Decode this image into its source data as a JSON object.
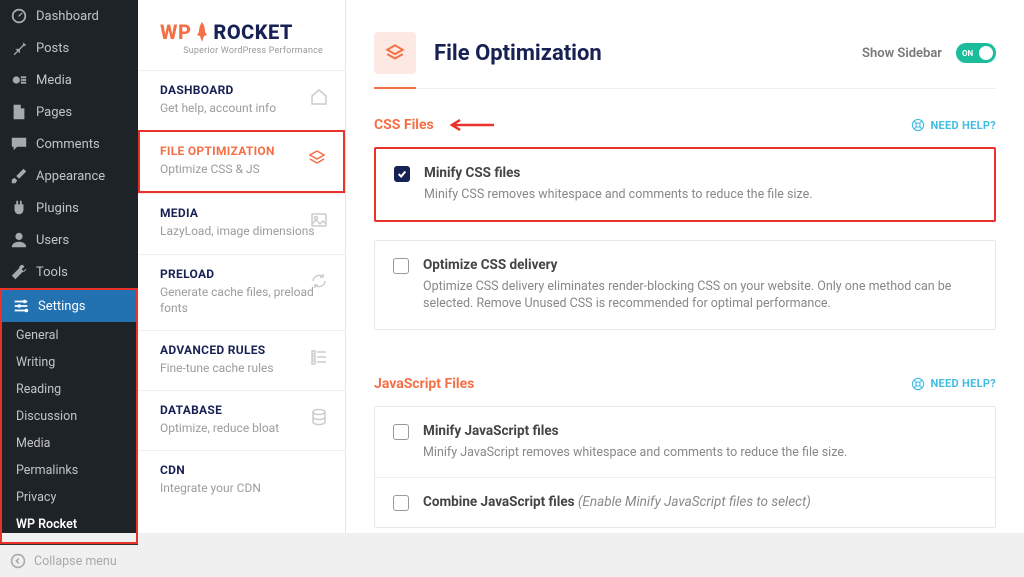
{
  "wp_sidebar": {
    "items": [
      {
        "label": "Dashboard",
        "icon": "gauge"
      },
      {
        "label": "Posts",
        "icon": "pin"
      },
      {
        "label": "Media",
        "icon": "media"
      },
      {
        "label": "Pages",
        "icon": "page"
      },
      {
        "label": "Comments",
        "icon": "comment"
      },
      {
        "label": "Appearance",
        "icon": "brush"
      },
      {
        "label": "Plugins",
        "icon": "plug"
      },
      {
        "label": "Users",
        "icon": "user"
      },
      {
        "label": "Tools",
        "icon": "wrench"
      },
      {
        "label": "Settings",
        "icon": "sliders",
        "active": true
      }
    ],
    "subs": [
      {
        "label": "General"
      },
      {
        "label": "Writing"
      },
      {
        "label": "Reading"
      },
      {
        "label": "Discussion"
      },
      {
        "label": "Media"
      },
      {
        "label": "Permalinks"
      },
      {
        "label": "Privacy"
      },
      {
        "label": "WP Rocket",
        "strong": true
      }
    ],
    "collapse": "Collapse menu"
  },
  "rocket_nav": {
    "logo_wp": "WP",
    "logo_rocket": "ROCKET",
    "logo_sub": "Superior WordPress Performance",
    "items": [
      {
        "title": "DASHBOARD",
        "desc": "Get help, account info",
        "icon": "home"
      },
      {
        "title": "FILE OPTIMIZATION",
        "desc": "Optimize CSS & JS",
        "icon": "layers",
        "active": true,
        "highlight": true
      },
      {
        "title": "MEDIA",
        "desc": "LazyLoad, image dimensions",
        "icon": "image"
      },
      {
        "title": "PRELOAD",
        "desc": "Generate cache files, preload fonts",
        "icon": "refresh"
      },
      {
        "title": "ADVANCED RULES",
        "desc": "Fine-tune cache rules",
        "icon": "list"
      },
      {
        "title": "DATABASE",
        "desc": "Optimize, reduce bloat",
        "icon": "db"
      },
      {
        "title": "CDN",
        "desc": "Integrate your CDN",
        "icon": "globe"
      }
    ]
  },
  "main": {
    "title": "File Optimization",
    "show_sidebar": "Show Sidebar",
    "toggle_on": "ON",
    "sections": [
      {
        "title": "CSS Files",
        "need_help": "NEED HELP?",
        "highlight_first": true,
        "options": [
          {
            "title": "Minify CSS files",
            "desc": "Minify CSS removes whitespace and comments to reduce the file size.",
            "checked": true
          },
          {
            "title": "Optimize CSS delivery",
            "desc": "Optimize CSS delivery eliminates render-blocking CSS on your website. Only one method can be selected. Remove Unused CSS is recommended for optimal performance.",
            "checked": false
          }
        ]
      },
      {
        "title": "JavaScript Files",
        "need_help": "NEED HELP?",
        "options": [
          {
            "title": "Minify JavaScript files",
            "desc": "Minify JavaScript removes whitespace and comments to reduce the file size.",
            "checked": false
          },
          {
            "title": "Combine JavaScript files",
            "hint": "(Enable Minify JavaScript files to select)",
            "desc": "",
            "checked": false
          }
        ]
      }
    ]
  }
}
